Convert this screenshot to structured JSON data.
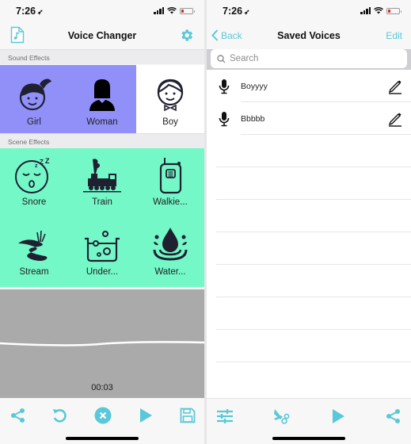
{
  "status": {
    "time": "7:26",
    "location_glyph": "➶"
  },
  "left": {
    "nav": {
      "title": "Voice Changer",
      "left_icon": "music-file-icon",
      "right_icon": "gear-icon"
    },
    "sound_effects": {
      "header": "Sound Effects",
      "items": [
        {
          "label": "Girl",
          "icon": "girl-icon",
          "selected": true
        },
        {
          "label": "Woman",
          "icon": "woman-icon",
          "selected": true
        },
        {
          "label": "Boy",
          "icon": "boy-icon",
          "selected": false
        }
      ]
    },
    "scene_effects": {
      "header": "Scene Effects",
      "items": [
        {
          "label": "Snore",
          "icon": "snore-icon"
        },
        {
          "label": "Train",
          "icon": "train-icon"
        },
        {
          "label": "Walkie...",
          "icon": "walkie-talkie-icon"
        },
        {
          "label": "Stream",
          "icon": "stream-icon"
        },
        {
          "label": "Under...",
          "icon": "underwater-icon"
        },
        {
          "label": "Water...",
          "icon": "water-drop-icon"
        }
      ]
    },
    "recording": {
      "elapsed": "00:03"
    },
    "toolbar": [
      "share-icon",
      "undo-icon",
      "cancel-icon",
      "play-icon",
      "save-icon"
    ]
  },
  "right": {
    "nav": {
      "back_label": "Back",
      "title": "Saved Voices",
      "edit_label": "Edit"
    },
    "search": {
      "placeholder": "Search",
      "value": ""
    },
    "voices": [
      {
        "name": "Boyyyy"
      },
      {
        "name": "Bbbbb"
      }
    ],
    "toolbar": [
      "sliders-icon",
      "scissors-icon",
      "play-icon",
      "share-icon"
    ]
  },
  "colors": {
    "accent": "#5ac8d8",
    "sound_selected": "#9090f8",
    "scene_bg": "#74f8c8",
    "wave_bg": "#aaaaaa"
  }
}
